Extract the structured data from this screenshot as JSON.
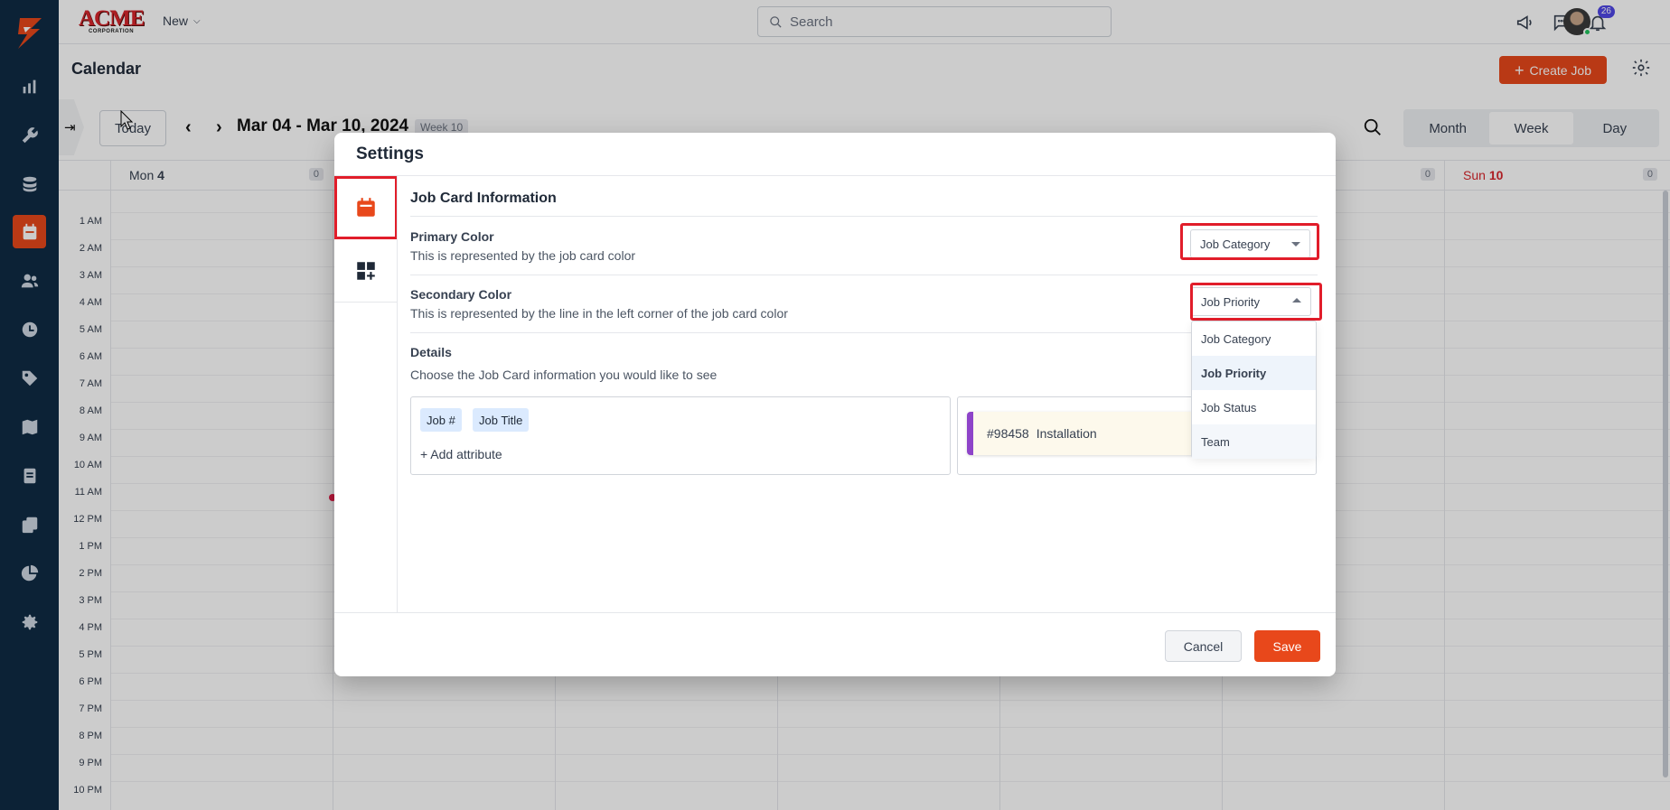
{
  "topbar": {
    "brand_main": "ACME",
    "brand_sub": "CORPORATION",
    "new_label": "New",
    "search_placeholder": "Search",
    "notification_count": "26"
  },
  "page": {
    "title": "Calendar",
    "create_job_label": "Create Job"
  },
  "toolbar": {
    "today_label": "Today",
    "date_range": "Mar 04 - Mar 10, 2024",
    "week_label": "Week 10",
    "views": [
      "Month",
      "Week",
      "Day"
    ],
    "active_view": "Week"
  },
  "calendar": {
    "days": [
      {
        "name": "Mon",
        "num": "4",
        "count": "0"
      },
      {
        "name": "",
        "num": "",
        "count": "0"
      },
      {
        "name": "Sun",
        "num": "10",
        "count": "0"
      }
    ],
    "times": [
      "1 AM",
      "2 AM",
      "3 AM",
      "4 AM",
      "5 AM",
      "6 AM",
      "7 AM",
      "8 AM",
      "9 AM",
      "10 AM",
      "11 AM",
      "12 PM",
      "1 PM",
      "2 PM",
      "3 PM",
      "4 PM",
      "5 PM",
      "6 PM",
      "7 PM",
      "8 PM",
      "9 PM",
      "10 PM"
    ]
  },
  "modal": {
    "title": "Settings",
    "section_title": "Job Card Information",
    "primary": {
      "label": "Primary Color",
      "desc": "This is represented by the job card color",
      "value": "Job Category"
    },
    "secondary": {
      "label": "Secondary Color",
      "desc": "This is represented by the line in the left corner of the job card color",
      "value": "Job Priority"
    },
    "dropdown_options": [
      "Job Category",
      "Job Priority",
      "Job Status",
      "Team"
    ],
    "details": {
      "label": "Details",
      "desc": "Choose the Job Card information you would like to see",
      "chips": [
        "Job #",
        "Job Title"
      ],
      "add_label": "+ Add attribute"
    },
    "preview": {
      "job_number": "#98458",
      "job_title": "Installation",
      "accent_color": "#8e44c9"
    },
    "cancel_label": "Cancel",
    "save_label": "Save"
  },
  "colors": {
    "accent": "#e8481b",
    "sidebar": "#0f2b44",
    "highlight": "#e11d2a"
  }
}
